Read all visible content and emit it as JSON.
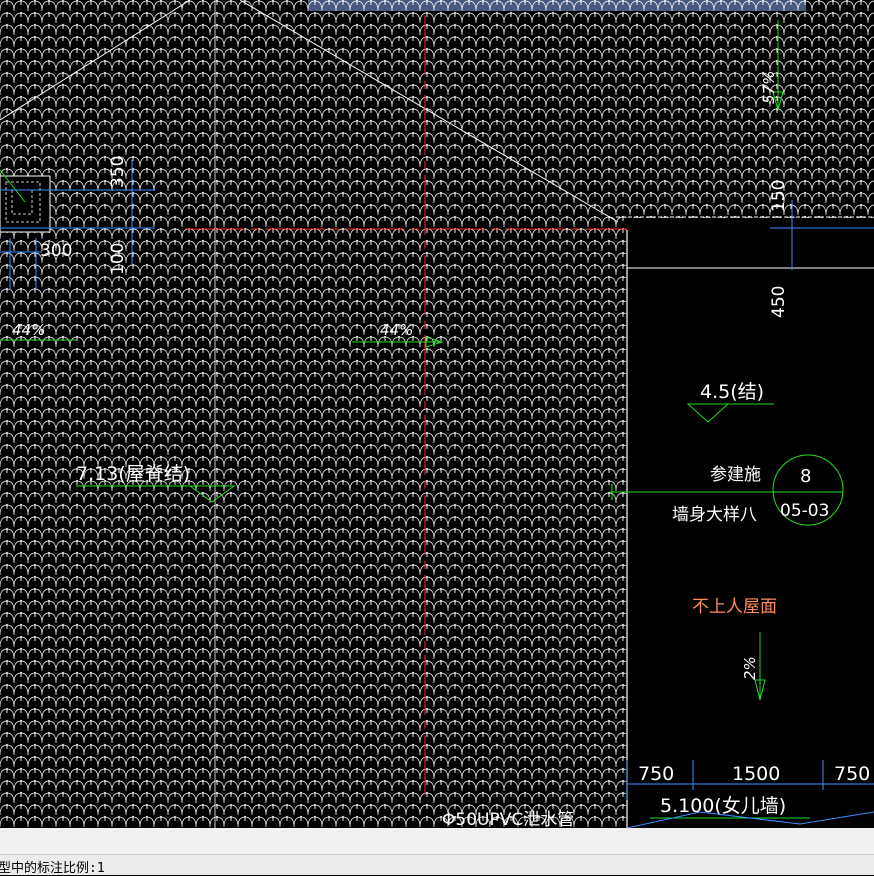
{
  "window": {
    "title_strip_color": "#4a5a7f"
  },
  "colors": {
    "background": "#000000",
    "hatch": "#ffffff",
    "axis_red": "#ff2a2a",
    "dimension_cyan": "#3a8fff",
    "leader_green": "#22dd22",
    "label_white": "#ffffff",
    "note_orange": "#ff8c5a",
    "status_bg": "#ececec"
  },
  "annotations": {
    "dim_350": "350",
    "dim_100": "100",
    "dim_300": "300",
    "slope_left": "44%",
    "slope_mid": "44%",
    "slope_right_top": "57%",
    "dim_150": "150",
    "dim_450": "450",
    "elev_structure": "4.5(结)",
    "elev_ridge": "7.13(屋脊结)",
    "ref_line1": "参建施",
    "ref_line2": "墙身大样八",
    "detail_number": "8",
    "detail_sheet": "05-03",
    "roof_note": "不上人屋面",
    "slope_flat": "2%",
    "dim_750_left": "750",
    "dim_1500": "1500",
    "dim_750_right": "750",
    "elev_parapet": "5.100(女儿墙)",
    "drain_pipe": "Φ50UPVC泄水管"
  },
  "status": {
    "text": "型中的标注比例:1"
  }
}
